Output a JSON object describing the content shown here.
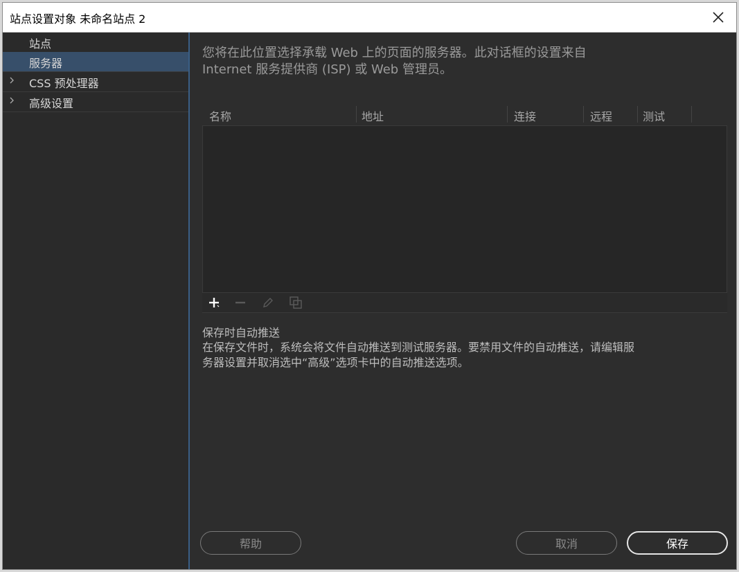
{
  "window": {
    "title": "站点设置对象 未命名站点 2",
    "close_icon": "close-icon"
  },
  "sidebar": {
    "items": [
      {
        "label": "站点",
        "selected": false,
        "expandable": false
      },
      {
        "label": "服务器",
        "selected": true,
        "expandable": false
      },
      {
        "label": "CSS 预处理器",
        "selected": false,
        "expandable": true
      },
      {
        "label": "高级设置",
        "selected": false,
        "expandable": true
      }
    ]
  },
  "main": {
    "intro_line1": "您将在此位置选择承载 Web 上的页面的服务器。此对话框的设置来自",
    "intro_line2": "Internet 服务提供商 (ISP) 或 Web 管理员。",
    "table": {
      "columns": [
        "名称",
        "地址",
        "连接",
        "远程",
        "测试"
      ],
      "rows": []
    },
    "toolbar": {
      "add_icon": "plus-icon",
      "remove_icon": "minus-icon",
      "edit_icon": "pencil-icon",
      "duplicate_icon": "duplicate-icon"
    },
    "autopush_title": "保存时自动推送",
    "autopush_line1": "在保存文件时，系统会将文件自动推送到测试服务器。要禁用文件的自动推送，请编辑服",
    "autopush_line2": "务器设置并取消选中“高级”选项卡中的自动推送选项。"
  },
  "buttons": {
    "help": "帮助",
    "cancel": "取消",
    "save": "保存"
  },
  "colors": {
    "background": "#2d2d2d",
    "selected": "#374f6a",
    "accent_border": "#3a5f86"
  }
}
